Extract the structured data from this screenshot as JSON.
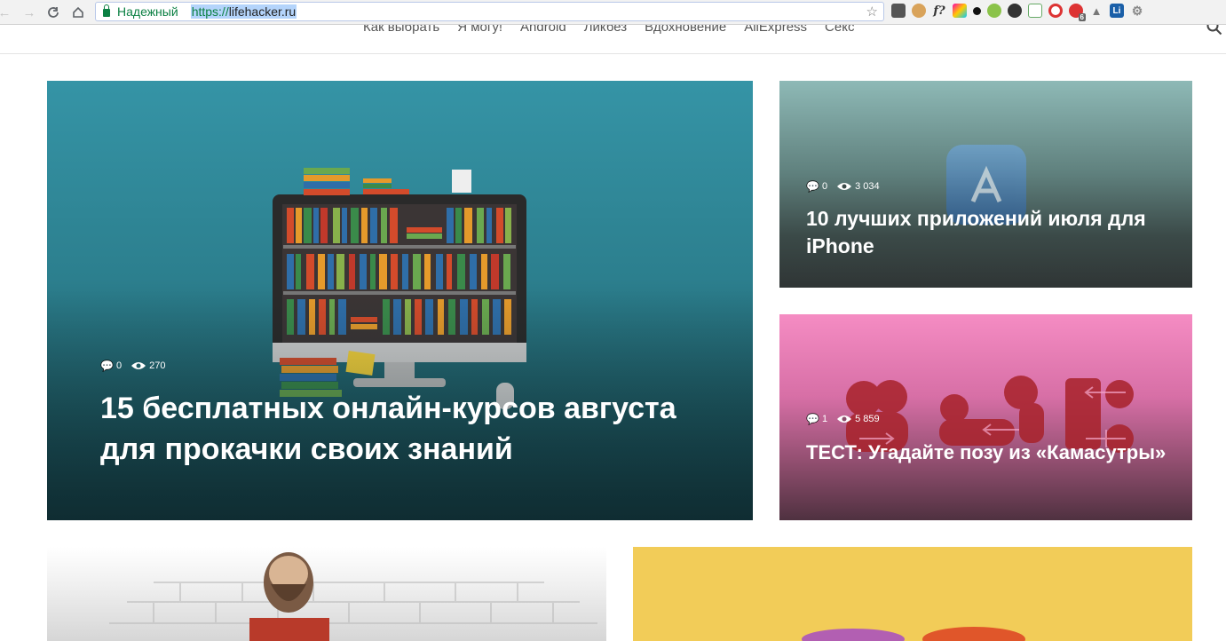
{
  "browser": {
    "secure_label": "Надежный",
    "url_scheme": "https://",
    "url_host": "lifehacker.ru"
  },
  "site_nav": {
    "items": [
      "Как выбрать",
      "Я могу!",
      "Android",
      "Ликбез",
      "Вдохновение",
      "AliExpress",
      "Секс"
    ]
  },
  "articles": [
    {
      "title": "15 бесплатных онлайн-курсов августа для прокачки своих знаний",
      "comments": "0",
      "views": "270"
    },
    {
      "title": "10 лучших приложений июля для iPhone",
      "comments": "0",
      "views": "3 034"
    },
    {
      "title": "ТЕСТ: Угадайте позу из «Камасутры»",
      "comments": "1",
      "views": "5 859"
    }
  ],
  "extensions": {
    "badge_count": "6"
  },
  "colors": {
    "secure_green": "#0b8043",
    "card_teal": "#3a94a4",
    "card_pink": "#f088c0",
    "card_yellow": "#f2cc58"
  }
}
